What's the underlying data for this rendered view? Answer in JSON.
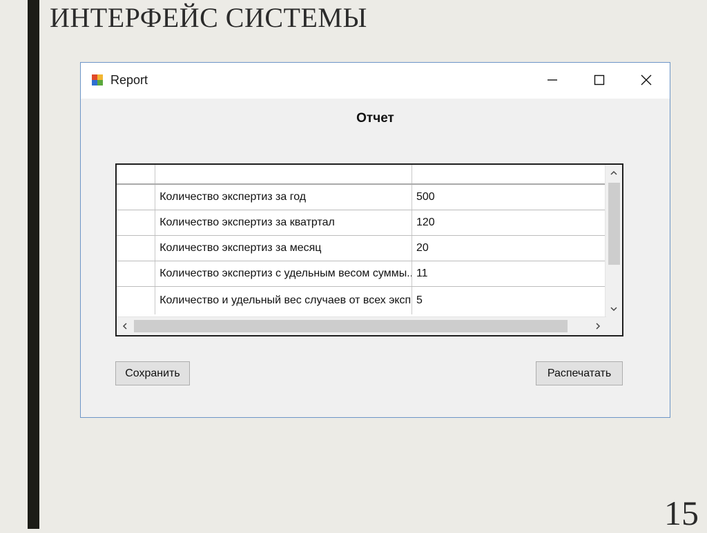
{
  "slide": {
    "title": "ИНТЕРФЕЙС СИСТЕМЫ",
    "page_number": "15"
  },
  "window": {
    "title": "Report",
    "icons": {
      "app": "app-icon",
      "minimize": "minimize-icon",
      "maximize": "maximize-icon",
      "close": "close-icon"
    }
  },
  "form": {
    "heading": "Отчет",
    "grid": {
      "columns": [
        "",
        ""
      ],
      "rows": [
        {
          "name": "Количество экспертиз за год",
          "value": "500"
        },
        {
          "name": "Количество экспертиз за кватртал",
          "value": "120"
        },
        {
          "name": "Количество экспертиз за месяц",
          "value": "20"
        },
        {
          "name": "Количество экспертиз с удельным весом суммы...",
          "value": "11"
        },
        {
          "name": "Количество и удельный вес случаев от всех эксп...",
          "value": "5"
        }
      ]
    },
    "buttons": {
      "save": "Сохранить",
      "print": "Распечатать"
    }
  },
  "colors": {
    "slide_background": "#ecebe6",
    "slide_bar": "#1c1c17",
    "window_border": "#6c95c7",
    "window_body": "#f0f0f0"
  }
}
